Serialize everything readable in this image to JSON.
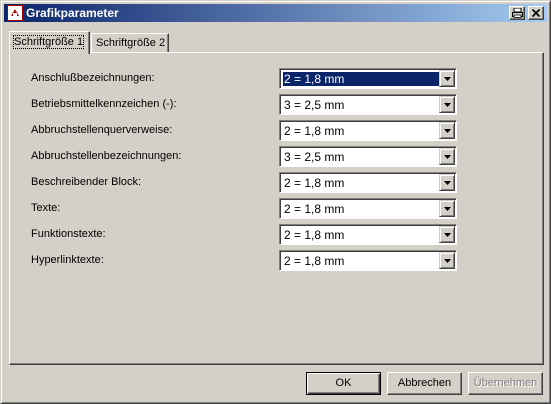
{
  "window": {
    "title": "Grafikparameter"
  },
  "tabs": [
    {
      "label": "Schriftgröße 1",
      "active": true
    },
    {
      "label": "Schriftgröße 2",
      "active": false
    }
  ],
  "rows": [
    {
      "label": "Anschlußbezeichnungen:",
      "value": "2 = 1,8 mm",
      "selected": true
    },
    {
      "label": "Betriebsmittelkennzeichen (-):",
      "value": "3 = 2,5 mm"
    },
    {
      "label": "Abbruchstellenquerverweise:",
      "value": "2 = 1,8 mm"
    },
    {
      "label": "Abbruchstellenbezeichnungen:",
      "value": "3 = 2,5 mm"
    },
    {
      "label": "Beschreibender Block:",
      "value": "2 = 1,8 mm"
    },
    {
      "label": "Texte:",
      "value": "2 = 1,8 mm"
    },
    {
      "label": "Funktionstexte:",
      "value": "2 = 1,8 mm"
    },
    {
      "label": "Hyperlinktexte:",
      "value": "2 = 1,8 mm"
    }
  ],
  "buttons": {
    "ok": "OK",
    "cancel": "Abbrechen",
    "apply": "Übernehmen"
  },
  "icons": {
    "app": "eplan-app-icon",
    "titlebar_button_1": "print-icon",
    "titlebar_button_2": "close-icon",
    "dropdown": "chevron-down-icon"
  },
  "colors": {
    "titlebar_start": "#0a246a",
    "titlebar_end": "#a6caf0",
    "selection": "#0a246a",
    "face": "#d4d0c8"
  }
}
